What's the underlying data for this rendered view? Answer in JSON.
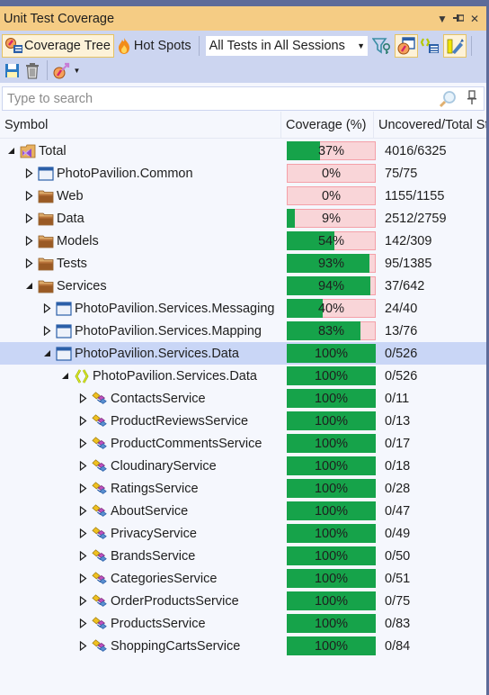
{
  "window": {
    "title": "Unit Test Coverage",
    "title_buttons": [
      {
        "name": "dropdown-icon",
        "glyph": "▼"
      },
      {
        "name": "pin-icon",
        "glyph": "⊣"
      },
      {
        "name": "close-icon",
        "glyph": "✕"
      }
    ]
  },
  "toolbar": {
    "coverage_tree_label": "Coverage Tree",
    "hot_spots_label": "Hot Spots",
    "session_combo_value": "All Tests in All Sessions"
  },
  "search": {
    "placeholder": "Type to search"
  },
  "columns": {
    "symbol": "Symbol",
    "coverage": "Coverage (%)",
    "uncovered": "Uncovered/Total Statements"
  },
  "colors": {
    "covered": "#16a34a",
    "uncovered": "#f9d5d8",
    "uncovered_border": "#f4a0a8",
    "selection": "#c9d6f6",
    "title_bar": "#f5cc84",
    "toolbar": "#ccd5f0"
  },
  "rows": [
    {
      "label": "Total",
      "icon": "solution",
      "depth": 0,
      "expanded": true,
      "coverage": 37,
      "coverage_label": "37%",
      "uncovered": "4016/6325"
    },
    {
      "label": "PhotoPavilion.Common",
      "icon": "assembly",
      "depth": 1,
      "expanded": false,
      "coverage": 0,
      "coverage_label": "0%",
      "uncovered": "75/75"
    },
    {
      "label": "Web",
      "icon": "folder",
      "depth": 1,
      "expanded": false,
      "coverage": 0,
      "coverage_label": "0%",
      "uncovered": "1155/1155"
    },
    {
      "label": "Data",
      "icon": "folder",
      "depth": 1,
      "expanded": false,
      "coverage": 9,
      "coverage_label": "9%",
      "uncovered": "2512/2759"
    },
    {
      "label": "Models",
      "icon": "folder",
      "depth": 1,
      "expanded": false,
      "coverage": 54,
      "coverage_label": "54%",
      "uncovered": "142/309"
    },
    {
      "label": "Tests",
      "icon": "folder",
      "depth": 1,
      "expanded": false,
      "coverage": 93,
      "coverage_label": "93%",
      "uncovered": "95/1385"
    },
    {
      "label": "Services",
      "icon": "folder",
      "depth": 1,
      "expanded": true,
      "coverage": 94,
      "coverage_label": "94%",
      "uncovered": "37/642"
    },
    {
      "label": "PhotoPavilion.Services.Messaging",
      "icon": "assembly",
      "depth": 2,
      "expanded": false,
      "coverage": 40,
      "coverage_label": "40%",
      "uncovered": "24/40"
    },
    {
      "label": "PhotoPavilion.Services.Mapping",
      "icon": "assembly",
      "depth": 2,
      "expanded": false,
      "coverage": 83,
      "coverage_label": "83%",
      "uncovered": "13/76"
    },
    {
      "label": "PhotoPavilion.Services.Data",
      "icon": "assembly",
      "depth": 2,
      "expanded": true,
      "selected": true,
      "coverage": 100,
      "coverage_label": "100%",
      "uncovered": "0/526"
    },
    {
      "label": "PhotoPavilion.Services.Data",
      "icon": "namespace",
      "depth": 3,
      "expanded": true,
      "coverage": 100,
      "coverage_label": "100%",
      "uncovered": "0/526"
    },
    {
      "label": "ContactsService",
      "icon": "class",
      "depth": 4,
      "expanded": false,
      "coverage": 100,
      "coverage_label": "100%",
      "uncovered": "0/11"
    },
    {
      "label": "ProductReviewsService",
      "icon": "class",
      "depth": 4,
      "expanded": false,
      "coverage": 100,
      "coverage_label": "100%",
      "uncovered": "0/13"
    },
    {
      "label": "ProductCommentsService",
      "icon": "class",
      "depth": 4,
      "expanded": false,
      "coverage": 100,
      "coverage_label": "100%",
      "uncovered": "0/17"
    },
    {
      "label": "CloudinaryService",
      "icon": "class",
      "depth": 4,
      "expanded": false,
      "coverage": 100,
      "coverage_label": "100%",
      "uncovered": "0/18"
    },
    {
      "label": "RatingsService",
      "icon": "class",
      "depth": 4,
      "expanded": false,
      "coverage": 100,
      "coverage_label": "100%",
      "uncovered": "0/28"
    },
    {
      "label": "AboutService",
      "icon": "class",
      "depth": 4,
      "expanded": false,
      "coverage": 100,
      "coverage_label": "100%",
      "uncovered": "0/47"
    },
    {
      "label": "PrivacyService",
      "icon": "class",
      "depth": 4,
      "expanded": false,
      "coverage": 100,
      "coverage_label": "100%",
      "uncovered": "0/49"
    },
    {
      "label": "BrandsService",
      "icon": "class",
      "depth": 4,
      "expanded": false,
      "coverage": 100,
      "coverage_label": "100%",
      "uncovered": "0/50"
    },
    {
      "label": "CategoriesService",
      "icon": "class",
      "depth": 4,
      "expanded": false,
      "coverage": 100,
      "coverage_label": "100%",
      "uncovered": "0/51"
    },
    {
      "label": "OrderProductsService",
      "icon": "class",
      "depth": 4,
      "expanded": false,
      "coverage": 100,
      "coverage_label": "100%",
      "uncovered": "0/75"
    },
    {
      "label": "ProductsService",
      "icon": "class",
      "depth": 4,
      "expanded": false,
      "coverage": 100,
      "coverage_label": "100%",
      "uncovered": "0/83"
    },
    {
      "label": "ShoppingCartsService",
      "icon": "class",
      "depth": 4,
      "expanded": false,
      "coverage": 100,
      "coverage_label": "100%",
      "uncovered": "0/84"
    }
  ]
}
